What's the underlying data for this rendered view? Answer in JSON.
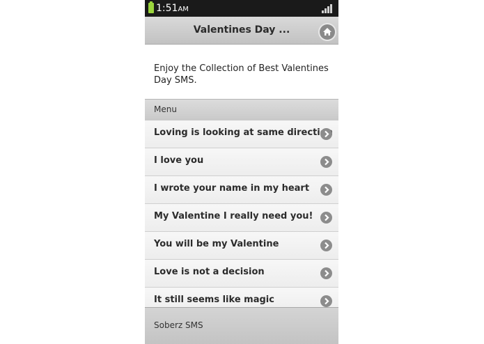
{
  "status_bar": {
    "time": "1:51",
    "ampm": "AM",
    "battery_icon": "battery-icon",
    "signal_icon": "signal-icon"
  },
  "header": {
    "title": "Valentines Day ...",
    "home_icon": "home-icon"
  },
  "intro": {
    "text": "Enjoy the Collection of Best Valentines Day SMS."
  },
  "menu": {
    "title": "Menu",
    "items": [
      {
        "label": "Loving is looking at same direction"
      },
      {
        "label": "I love you"
      },
      {
        "label": "I wrote your name in my heart"
      },
      {
        "label": "My Valentine I really need you!"
      },
      {
        "label": "You will be my Valentine"
      },
      {
        "label": "Love is not a decision"
      },
      {
        "label": "It still seems like magic"
      }
    ]
  },
  "footer": {
    "text": "Soberz SMS"
  },
  "colors": {
    "status_bar_bg": "#1a1a1a",
    "battery": "#9bd53c",
    "header_bg": "#cccccc",
    "chevron": "#8c8c8c"
  }
}
